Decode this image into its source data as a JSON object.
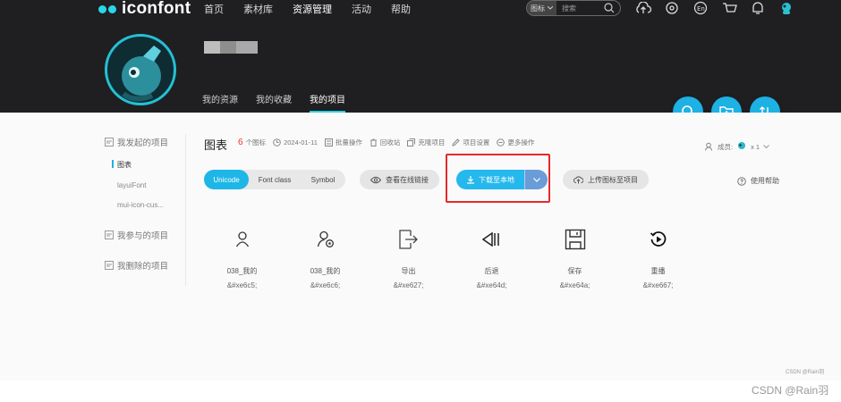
{
  "brand": {
    "name": "iconfont"
  },
  "nav": {
    "items": [
      "首页",
      "素材库",
      "资源管理",
      "活动",
      "帮助"
    ],
    "active_index": 2
  },
  "search": {
    "type": "图标",
    "placeholder": "搜索"
  },
  "user": {
    "tabs": [
      "我的资源",
      "我的收藏",
      "我的项目"
    ],
    "active_tab": 2
  },
  "sidebar": {
    "my_projects": "我发起的项目",
    "projects": [
      "图表",
      "layuiFont",
      "mui-icon-cus..."
    ],
    "joined": "我参与的项目",
    "deleted": "我删除的项目"
  },
  "project": {
    "title": "图表",
    "count": "6",
    "count_unit": "个图标",
    "date": "2024-01-11",
    "batch": "批量操作",
    "recycle": "回收站",
    "clone": "克隆项目",
    "settings": "项目设置",
    "more": "更多操作",
    "members_label": "成员:",
    "members_count": "x 1"
  },
  "toolbar": {
    "modes": [
      "Unicode",
      "Font class",
      "Symbol"
    ],
    "active_mode": "Unicode",
    "view_link": "查看在线链接",
    "download": "下载至本地",
    "upload": "上传图标至项目",
    "help": "使用帮助"
  },
  "icons": [
    {
      "name": "038_我的",
      "code": "&#xe6c5;",
      "icon": "user-icon"
    },
    {
      "name": "038_我的",
      "code": "&#xe6c6;",
      "icon": "user-settings-icon"
    },
    {
      "name": "导出",
      "code": "&#xe627;",
      "icon": "export-icon"
    },
    {
      "name": "后退",
      "code": "&#xe64d;",
      "icon": "rewind-icon"
    },
    {
      "name": "保存",
      "code": "&#xe64a;",
      "icon": "save-icon"
    },
    {
      "name": "重播",
      "code": "&#xe667;",
      "icon": "replay-icon"
    }
  ],
  "watermark": {
    "small": "CSDN @Rain羽",
    "large": "CSDN @Rain羽"
  },
  "colors": {
    "accent": "#1db1e4",
    "header": "#1f1f22",
    "highlight": "#e62a2a",
    "count": "#e33333"
  }
}
